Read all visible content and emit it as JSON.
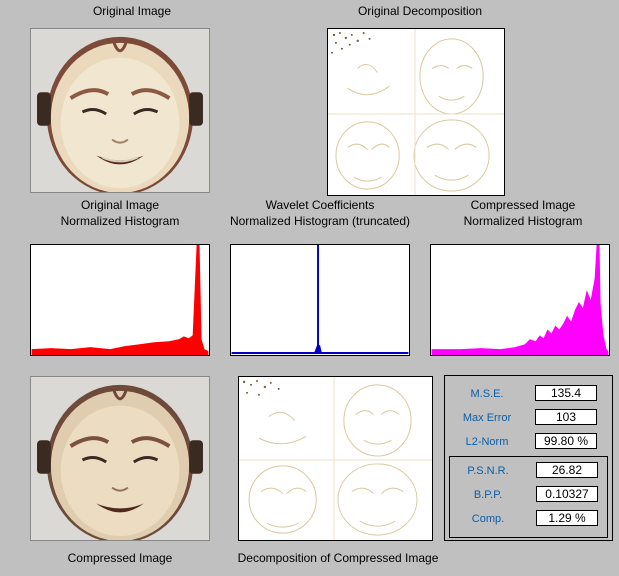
{
  "labels": {
    "original_image": "Original Image",
    "original_decomposition": "Original Decomposition",
    "orig_hist_line1": "Original Image",
    "orig_hist_line2": "Normalized Histogram",
    "wav_hist_line1": "Wavelet Coefficients",
    "wav_hist_line2": "Normalized Histogram (truncated)",
    "comp_hist_line1": "Compressed Image",
    "comp_hist_line2": "Normalized Histogram",
    "compressed_image": "Compressed Image",
    "decomp_compressed": "Decomposition of Compressed Image"
  },
  "stats": {
    "mse": {
      "label": "M.S.E.",
      "value": "135.4"
    },
    "max_error": {
      "label": "Max Error",
      "value": "103"
    },
    "l2_norm": {
      "label": "L2-Norm",
      "value": "99.80 %"
    },
    "psnr": {
      "label": "P.S.N.R.",
      "value": "26.82"
    },
    "bpp": {
      "label": "B.P.P.",
      "value": "0.10327"
    },
    "comp": {
      "label": "Comp.",
      "value": "1.29 %"
    }
  },
  "colors": {
    "background": "#c0c0c0",
    "original_hist": "#ff0000",
    "wavelet_hist": "#0000c8",
    "compressed_hist": "#ff00ff",
    "stat_label": "#0b5fa8"
  }
}
